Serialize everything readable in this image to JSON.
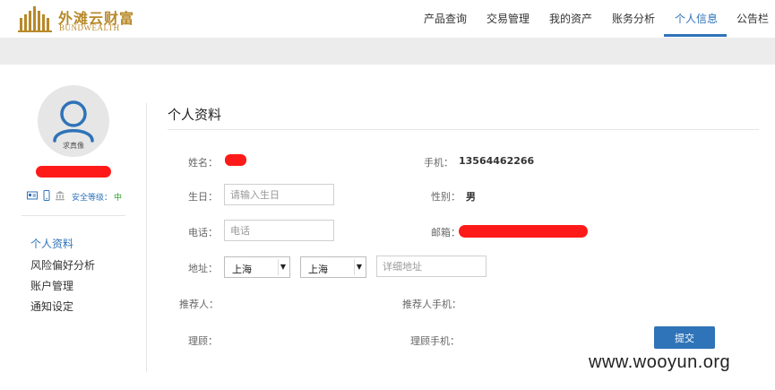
{
  "brand": {
    "name_cn": "外滩云财富",
    "name_en": "BUNDWEALTH",
    "color": "#b8892a"
  },
  "nav": {
    "items": [
      {
        "label": "产品查询"
      },
      {
        "label": "交易管理"
      },
      {
        "label": "我的资产"
      },
      {
        "label": "账务分析"
      },
      {
        "label": "个人信息",
        "active": true
      },
      {
        "label": "公告栏"
      }
    ],
    "accent_color": "#2f73b8"
  },
  "profile": {
    "avatar_caption": "求真像",
    "security_label": "安全等级：",
    "security_level": "中"
  },
  "side_menu": [
    {
      "label": "个人资料",
      "active": true
    },
    {
      "label": "风险偏好分析"
    },
    {
      "label": "账户管理"
    },
    {
      "label": "通知设定"
    }
  ],
  "form": {
    "title": "个人资料",
    "name_label": "姓名：",
    "phone_label": "手机：",
    "phone_value": "13564462266",
    "birthday_label": "生日：",
    "birthday_placeholder": "请输入生日",
    "gender_label": "性别：",
    "gender_value": "男",
    "tel_label": "电话：",
    "tel_placeholder": "电话",
    "email_label": "邮箱：",
    "address_label": "地址：",
    "province_value": "上海",
    "city_value": "上海",
    "address_placeholder": "详细地址",
    "referrer_label": "推荐人：",
    "referrer_phone_label": "推荐人手机：",
    "advisor_label": "理顾：",
    "advisor_phone_label": "理顾手机：",
    "submit_label": "提交"
  },
  "watermark": "www.wooyun.org"
}
